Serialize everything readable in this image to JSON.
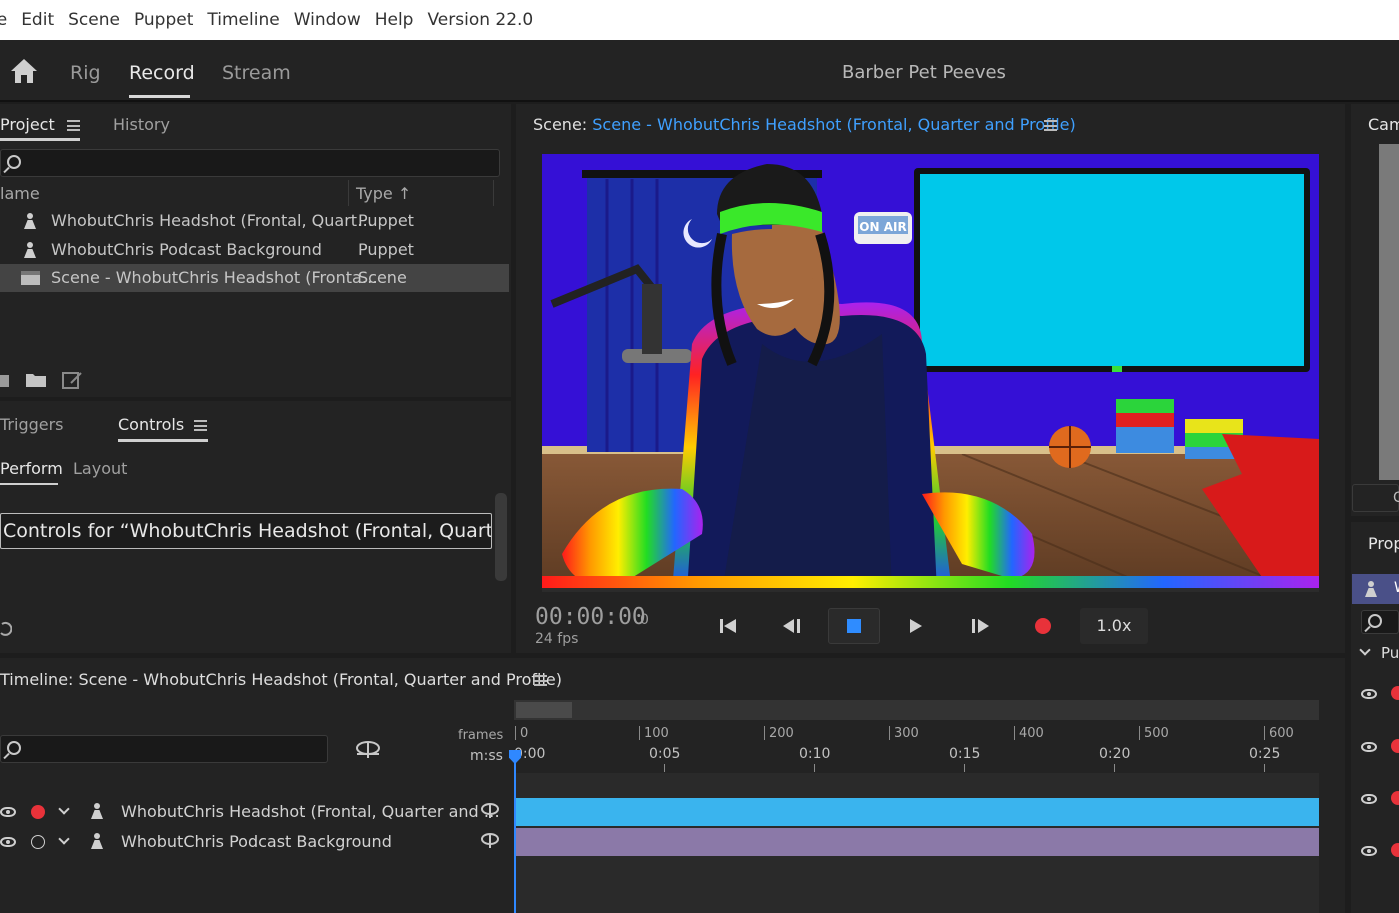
{
  "menu": [
    "le",
    "Edit",
    "Scene",
    "Puppet",
    "Timeline",
    "Window",
    "Help",
    "Version 22.0"
  ],
  "workspace": {
    "tabs": [
      "Rig",
      "Record",
      "Stream"
    ],
    "active_tab": "Record",
    "project_title": "Barber Pet Peeves"
  },
  "project_panel": {
    "tabs": [
      "Project",
      "History"
    ],
    "columns": {
      "name": "lame",
      "type": "Type"
    },
    "sort_arrow": "↑",
    "items": [
      {
        "name": "WhobutChris Headshot (Frontal, Quart…",
        "type": "Puppet",
        "icon": "puppet-icon"
      },
      {
        "name": "WhobutChris Podcast Background",
        "type": "Puppet",
        "icon": "puppet-icon"
      },
      {
        "name": "Scene - WhobutChris Headshot (Fronta…",
        "type": "Scene",
        "icon": "scene-icon",
        "selected": true
      }
    ]
  },
  "controls_panel": {
    "tabs": [
      "Triggers",
      "Controls"
    ],
    "subtabs": [
      "Perform",
      "Layout"
    ],
    "title": "Controls for “WhobutChris Headshot (Frontal, Quarter and Profile)”"
  },
  "scene_panel": {
    "label": "Scene:",
    "scene_name": "Scene - WhobutChris Headshot (Frontal, Quarter and Profile)",
    "on_air": "ON AIR",
    "timecode": "00:00:00",
    "frame": "0",
    "fps": "24 fps",
    "speed": "1.0x"
  },
  "timeline": {
    "title": "Timeline: Scene - WhobutChris Headshot (Frontal, Quarter and Profile)",
    "frames_label": "frames",
    "time_label": "m:ss",
    "frame_ticks": [
      "0",
      "100",
      "200",
      "300",
      "400",
      "500",
      "600"
    ],
    "time_ticks": [
      "0:00",
      "0:05",
      "0:10",
      "0:15",
      "0:20",
      "0:25"
    ],
    "tracks": [
      {
        "name": "WhobutChris Headshot (Frontal, Quarter and …",
        "armed": true,
        "color": "#3ab4ee"
      },
      {
        "name": "WhobutChris Podcast Background",
        "armed": false,
        "color": "#8b79a8"
      }
    ]
  },
  "right_panels": {
    "camera_label": "Cam",
    "camera_button": "C",
    "properties_label": "Prop",
    "prop_item": "W",
    "section_label": "Pu"
  },
  "colors": {
    "accent": "#3fa0ff",
    "record": "#e8323a",
    "stage_bg": "#3510d6",
    "monitor": "#00c8ea"
  }
}
